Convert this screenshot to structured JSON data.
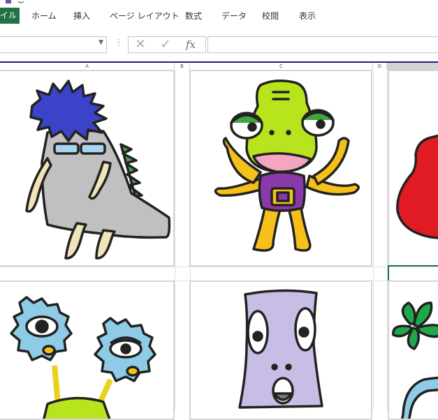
{
  "ribbon": {
    "tabs": [
      {
        "label": "イル",
        "active": true
      },
      {
        "label": "ホーム"
      },
      {
        "label": "挿入"
      },
      {
        "label": "ページ レイアウト"
      },
      {
        "label": "数式"
      },
      {
        "label": "データ"
      },
      {
        "label": "校閲"
      },
      {
        "label": "表示"
      }
    ],
    "accent": "#217346"
  },
  "formula_bar": {
    "name_box_value": "",
    "formula_value": "",
    "fx_label": "fx"
  },
  "columns": [
    "A",
    "B",
    "C",
    "D"
  ],
  "images": [
    {
      "name": "blue-haired-gray-monster"
    },
    {
      "name": "green-frog-monster"
    },
    {
      "name": "red-monster-partial"
    },
    {
      "name": "blue-gear-eye-monsters"
    },
    {
      "name": "purple-tube-monster"
    },
    {
      "name": "green-leaf-monster-partial"
    }
  ]
}
